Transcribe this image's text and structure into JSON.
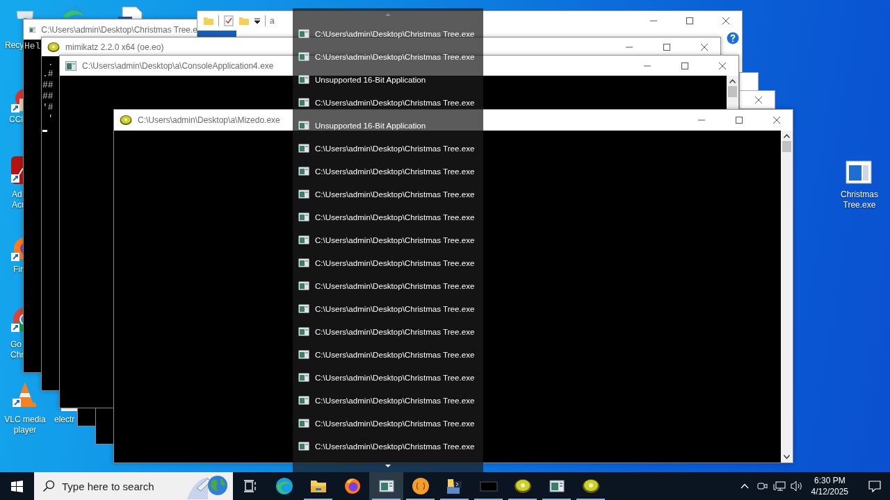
{
  "desktop_icons": [
    {
      "kind": "recycle-bin",
      "lines": [
        "Recy"
      ]
    },
    {
      "kind": "edge"
    },
    {
      "kind": "document"
    },
    {
      "kind": "ccleaner",
      "lines": [
        "CCl"
      ]
    },
    {
      "kind": "acrobat",
      "lines": [
        "Ad",
        "Acr"
      ]
    },
    {
      "kind": "firefox",
      "lines": [
        "Fir"
      ]
    },
    {
      "kind": "chrome",
      "lines": [
        "Go",
        "Chr"
      ]
    },
    {
      "kind": "vlc",
      "lines": [
        "VLC media",
        "player"
      ]
    },
    {
      "kind": "electron",
      "lines": [
        "electr"
      ]
    },
    {
      "kind": "installer",
      "lines": [
        "Christmas",
        "Tree.exe"
      ]
    }
  ],
  "explorer_window": {
    "title": "a"
  },
  "windows": [
    {
      "kind": "console",
      "title": "C:\\Users\\admin\\Desktop\\Christmas Tree.e",
      "console_lines": [
        "Hel"
      ]
    },
    {
      "kind": "kiwi",
      "title": "mimikatz 2.2.0 x64 (oe.eo)",
      "console_lines": [
        " .",
        ".#",
        "##",
        "##",
        "'#",
        " '"
      ]
    },
    {
      "kind": "console",
      "title": "C:\\Users\\admin\\Desktop\\a\\ConsoleApplication4.exe"
    },
    {
      "kind": "kiwi",
      "title": "C:\\Users\\admin\\Desktop\\a\\Mizedo.exe"
    }
  ],
  "jump_list": {
    "items": [
      {
        "title": "C:\\Users\\admin\\Desktop\\Christmas Tree.exe"
      },
      {
        "title": "C:\\Users\\admin\\Desktop\\Christmas Tree.exe"
      },
      {
        "title": "Unsupported 16-Bit Application"
      },
      {
        "title": "C:\\Users\\admin\\Desktop\\Christmas Tree.exe"
      },
      {
        "title": "Unsupported 16-Bit Application"
      },
      {
        "title": "C:\\Users\\admin\\Desktop\\Christmas Tree.exe"
      },
      {
        "title": "C:\\Users\\admin\\Desktop\\Christmas Tree.exe"
      },
      {
        "title": "C:\\Users\\admin\\Desktop\\Christmas Tree.exe"
      },
      {
        "title": "C:\\Users\\admin\\Desktop\\Christmas Tree.exe"
      },
      {
        "title": "C:\\Users\\admin\\Desktop\\Christmas Tree.exe"
      },
      {
        "title": "C:\\Users\\admin\\Desktop\\Christmas Tree.exe"
      },
      {
        "title": "C:\\Users\\admin\\Desktop\\Christmas Tree.exe"
      },
      {
        "title": "C:\\Users\\admin\\Desktop\\Christmas Tree.exe"
      },
      {
        "title": "C:\\Users\\admin\\Desktop\\Christmas Tree.exe"
      },
      {
        "title": "C:\\Users\\admin\\Desktop\\Christmas Tree.exe"
      },
      {
        "title": "C:\\Users\\admin\\Desktop\\Christmas Tree.exe"
      },
      {
        "title": "C:\\Users\\admin\\Desktop\\Christmas Tree.exe"
      },
      {
        "title": "C:\\Users\\admin\\Desktop\\Christmas Tree.exe"
      },
      {
        "title": "C:\\Users\\admin\\Desktop\\Christmas Tree.exe"
      }
    ]
  },
  "taskbar": {
    "search": {
      "placeholder": "Type here to search"
    },
    "apps": [
      {
        "kind": "edge",
        "running": false,
        "selected": false
      },
      {
        "kind": "explorer",
        "running": true,
        "selected": false
      },
      {
        "kind": "firefox",
        "running": false,
        "selected": false
      },
      {
        "kind": "console",
        "running": true,
        "selected": true
      },
      {
        "kind": "orange",
        "running": true,
        "selected": false
      },
      {
        "kind": "python",
        "running": true,
        "selected": false
      },
      {
        "kind": "blank",
        "running": true,
        "selected": false
      },
      {
        "kind": "kiwi",
        "running": true,
        "selected": false
      },
      {
        "kind": "console",
        "running": true,
        "selected": false
      },
      {
        "kind": "kiwi",
        "running": true,
        "selected": false
      }
    ],
    "clock": {
      "time": "6:30 PM",
      "date": "4/12/2025"
    }
  }
}
